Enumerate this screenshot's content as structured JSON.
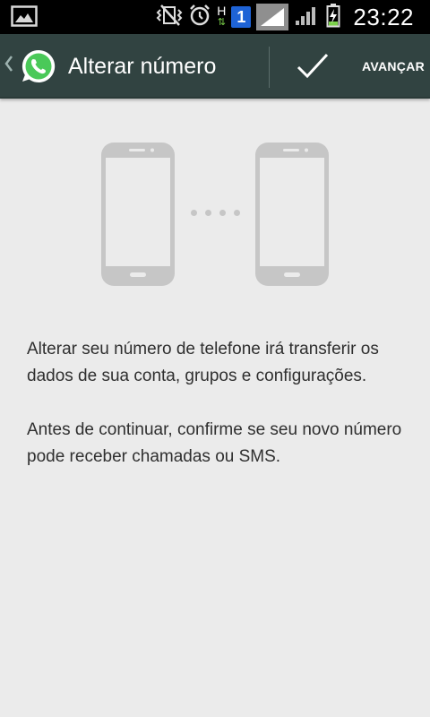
{
  "status_bar": {
    "time": "23:22",
    "network_type": "H",
    "sim_slot": "1",
    "icons": [
      "gallery-notification-icon",
      "vibrate-icon",
      "alarm-icon",
      "hspa-icon",
      "sim-1-icon",
      "signal-sim1-icon",
      "signal-sim2-icon",
      "battery-charging-icon"
    ]
  },
  "action_bar": {
    "title": "Alterar número",
    "next_label": "AVANÇAR",
    "logo": "whatsapp-logo-icon",
    "check": "check-icon",
    "background": "#314341"
  },
  "content": {
    "paragraph_1": "Alterar seu número de telefone irá transferir os dados de sua conta, grupos e configurações.",
    "paragraph_2": "Antes de continuar, confirme se seu novo número pode receber chamadas ou SMS.",
    "illustration": [
      "phone-icon",
      "transfer-dots",
      "phone-icon"
    ]
  },
  "colors": {
    "background": "#ebebeb",
    "text": "#2f2f2f",
    "illustration": "#c6c6c6",
    "whatsapp_green": "#4ac959"
  }
}
